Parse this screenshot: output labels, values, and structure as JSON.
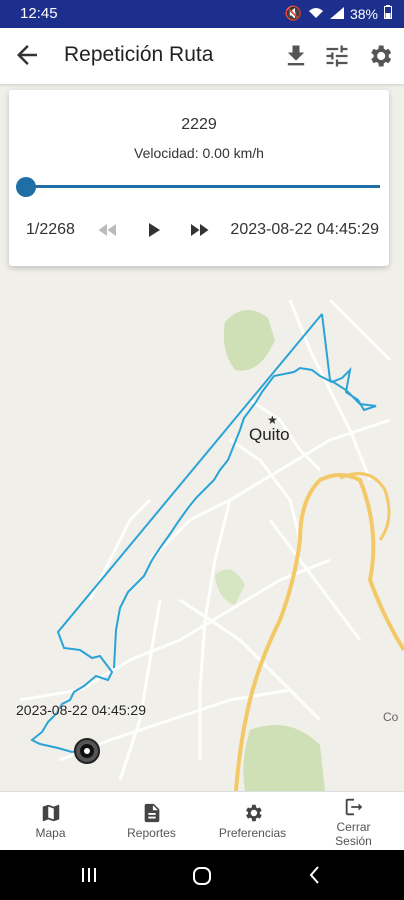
{
  "status": {
    "time": "12:45",
    "battery": "38%"
  },
  "appbar": {
    "title": "Repetición Ruta"
  },
  "player": {
    "counter": "2229",
    "speed": "Velocidad: 0.00 km/h",
    "position": "1/2268",
    "datetime": "2023-08-22 04:45:29",
    "progress": 0.0
  },
  "map": {
    "city_label": "Quito",
    "edge_label": "Co",
    "end_label": "2023-08-22 04:45:29"
  },
  "nav": {
    "items": [
      {
        "label": "Mapa"
      },
      {
        "label": "Reportes"
      },
      {
        "label": "Preferencias"
      },
      {
        "label": "Cerrar Sesión"
      }
    ]
  },
  "colors": {
    "route": "#2aa3d6",
    "statusbar": "#1c2f8c",
    "accent": "#1f6fa6"
  },
  "icons": {
    "back": "arrow-left-icon",
    "download": "download-icon",
    "filter": "tune-icon",
    "settings": "gear-icon",
    "rewind": "fast-rewind-icon",
    "play": "play-icon",
    "forward": "fast-forward-icon",
    "map": "map-icon",
    "reports": "document-icon",
    "prefs": "gear-icon",
    "logout": "exit-icon"
  }
}
